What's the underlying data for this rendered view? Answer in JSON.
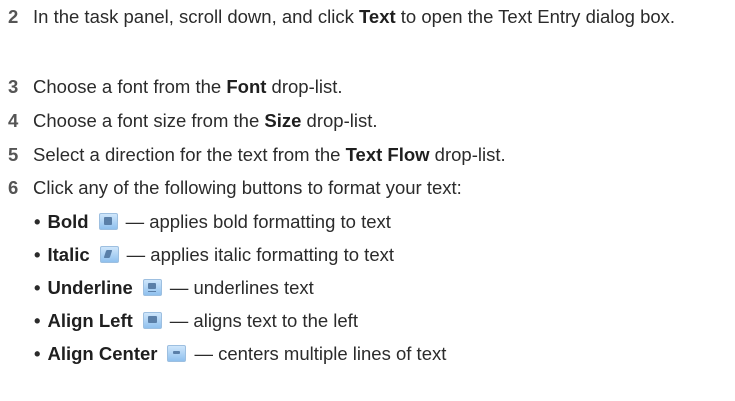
{
  "steps": [
    {
      "num": "2",
      "pre": "In the task panel, scroll down, and click ",
      "bold": "Text",
      "post": " to open the Text Entry dialog box."
    },
    {
      "num": "3",
      "pre": "Choose a font from the ",
      "bold": "Font",
      "post": " drop-list."
    },
    {
      "num": "4",
      "pre": "Choose a font size from the ",
      "bold": "Size",
      "post": " drop-list."
    },
    {
      "num": "5",
      "pre": "Select a direction for the text from the ",
      "bold": "Text Flow",
      "post": " drop-list."
    },
    {
      "num": "6",
      "pre": "Click any of the following buttons to format your text:",
      "bold": "",
      "post": ""
    }
  ],
  "bullets": [
    {
      "name": "Bold",
      "icon": "bold-icon",
      "desc": "— applies bold formatting to text"
    },
    {
      "name": "Italic",
      "icon": "italic-icon",
      "desc": "— applies italic formatting to text"
    },
    {
      "name": "Underline",
      "icon": "underline-icon",
      "desc": " — underlines text"
    },
    {
      "name": "Align Left",
      "icon": "align-left-icon",
      "desc": "— aligns text to the left"
    },
    {
      "name": "Align Center",
      "icon": "align-center-icon",
      "desc": "— centers multiple lines of text"
    }
  ],
  "bullet_char": "•"
}
